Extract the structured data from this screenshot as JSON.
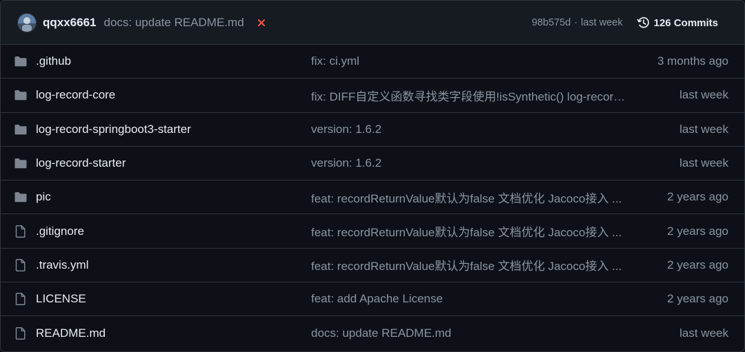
{
  "header": {
    "author": "qqxx6661",
    "commit_message": "docs: update README.md",
    "status": "failed",
    "sha": "98b575d",
    "separator": "·",
    "commit_time": "last week",
    "commits_label": "126 Commits"
  },
  "colors": {
    "folder": "#7d8590",
    "file": "#7d8590",
    "status_failed": "#f85149"
  },
  "rows": [
    {
      "type": "folder",
      "icon": "folder-icon",
      "name": ".github",
      "message": "fix: ci.yml",
      "time": "3 months ago"
    },
    {
      "type": "folder",
      "icon": "folder-icon",
      "name": "log-record-core",
      "message": "fix: DIFF自定义函数寻找类字段使用!isSynthetic() log-record-core",
      "time": "last week"
    },
    {
      "type": "folder",
      "icon": "folder-icon",
      "name": "log-record-springboot3-starter",
      "message": "version: 1.6.2",
      "time": "last week"
    },
    {
      "type": "folder",
      "icon": "folder-icon",
      "name": "log-record-starter",
      "message": "version: 1.6.2",
      "time": "last week"
    },
    {
      "type": "folder",
      "icon": "folder-icon",
      "name": "pic",
      "message": "feat: recordReturnValue默认为false 文档优化 Jacoco接入 ...",
      "time": "2 years ago"
    },
    {
      "type": "file",
      "icon": "file-icon",
      "name": ".gitignore",
      "message": "feat: recordReturnValue默认为false 文档优化 Jacoco接入 ...",
      "time": "2 years ago"
    },
    {
      "type": "file",
      "icon": "file-icon",
      "name": ".travis.yml",
      "message": "feat: recordReturnValue默认为false 文档优化 Jacoco接入 ...",
      "time": "2 years ago"
    },
    {
      "type": "file",
      "icon": "file-icon",
      "name": "LICENSE",
      "message": "feat: add Apache License",
      "time": "2 years ago"
    },
    {
      "type": "file",
      "icon": "file-icon",
      "name": "README.md",
      "message": "docs: update README.md",
      "time": "last week"
    }
  ]
}
